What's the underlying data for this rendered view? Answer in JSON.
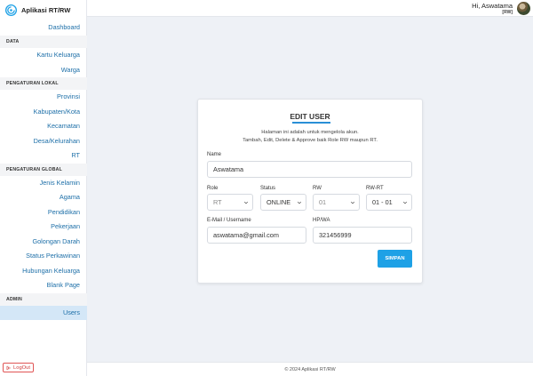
{
  "app": {
    "title": "Aplikasi RT/RW",
    "footer": "© 2024 Aplikasi RT/RW"
  },
  "user": {
    "name": "Hi, Aswatama",
    "role": "[RW]"
  },
  "sidebar": {
    "dashboard": "Dashboard",
    "data_section": "DATA",
    "data_items": [
      "Kartu Keluarga",
      "Warga"
    ],
    "lokal_section": "PENGATURAN LOKAL",
    "lokal_items": [
      "Provinsi",
      "Kabupaten/Kota",
      "Kecamatan",
      "Desa/Kelurahan",
      "RT"
    ],
    "global_section": "PENGATURAN GLOBAL",
    "global_items": [
      "Jenis Kelamin",
      "Agama",
      "Pendidikan",
      "Pekerjaan",
      "Golongan Darah",
      "Status Perkawinan",
      "Hubungan Keluarga",
      "Blank Page"
    ],
    "admin_section": "ADMIN",
    "admin_items": [
      "Users"
    ],
    "logout": "LogOut"
  },
  "form": {
    "title": "EDIT USER",
    "desc_line1": "Halaman ini adalah untuk mengelola akun.",
    "desc_line2": "Tambah, Edit, Delete & Approve baik Role RW maupun RT.",
    "name_label": "Name",
    "name_value": "Aswatama",
    "role_label": "Role",
    "role_value": "RT",
    "status_label": "Status",
    "status_value": "ONLINE",
    "rw_label": "RW",
    "rw_value": "01",
    "rwrt_label": "RW-RT",
    "rwrt_value": "01 - 01",
    "email_label": "E-Mail / Username",
    "email_value": "aswatama@gmail.com",
    "phone_label": "HP/WA",
    "phone_value": "321456999",
    "submit_label": "SIMPAN"
  },
  "colors": {
    "accent": "#1ea1e6",
    "nav_text": "#1d6fa8",
    "active_bg": "#d4e7f7",
    "logout": "#d03d3d"
  }
}
